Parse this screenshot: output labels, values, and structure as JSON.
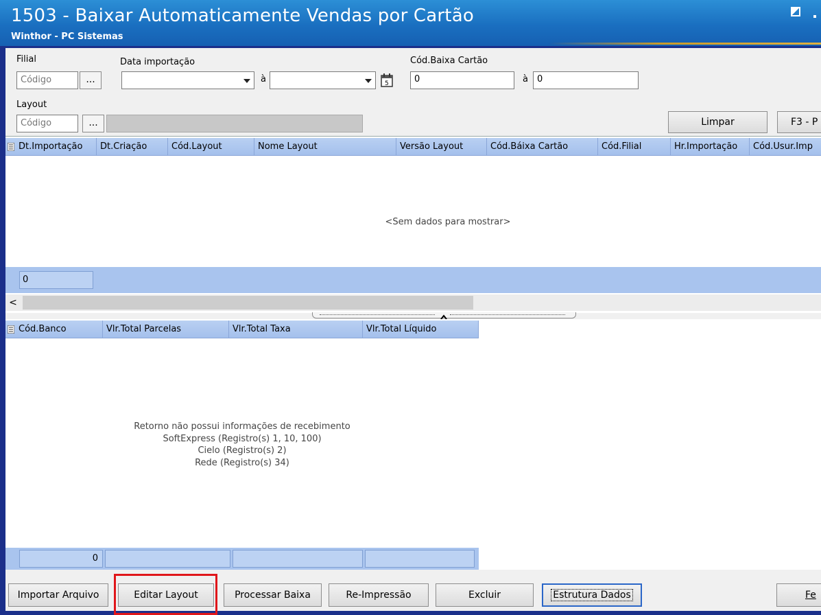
{
  "window": {
    "title": "1503 - Baixar Automaticamente Vendas por Cartão",
    "subtitle": "Winthor - PC Sistemas"
  },
  "filters": {
    "filial_label": "Filial",
    "filial_placeholder": "Código",
    "data_importacao_label": "Data importação",
    "date_separator": "à",
    "cod_baixa_label": "Cód.Baixa Cartão",
    "cod_baixa_from": "0",
    "cod_baixa_to": "0",
    "layout_label": "Layout",
    "layout_placeholder": "Código",
    "ellipsis": "...",
    "limpar": "Limpar",
    "pesquisar": "F3 - P"
  },
  "grid1": {
    "columns": [
      "Dt.Importação",
      "Dt.Criação",
      "Cód.Layout",
      "Nome Layout",
      "Versão Layout",
      "Cód.Báixa Cartão",
      "Cód.Filial",
      "Hr.Importação",
      "Cód.Usur.Imp"
    ],
    "empty_text": "<Sem dados para mostrar>",
    "footer_count": "0",
    "scroll_left": "<"
  },
  "grid2": {
    "columns": [
      "Cód.Banco",
      "Vlr.Total Parcelas",
      "Vlr.Total Taxa",
      "Vlr.Total Líquido"
    ],
    "message_lines": [
      "Retorno não possui informações de recebimento",
      "SoftExpress (Registro(s) 1, 10, 100)",
      "Cielo (Registro(s) 2)",
      "Rede (Registro(s) 34)"
    ],
    "footer_first": "0"
  },
  "buttons": {
    "importar": "Importar Arquivo",
    "editar": "Editar Layout",
    "processar": "Processar Baixa",
    "reimpressao": "Re-Impressão",
    "excluir": "Excluir",
    "estrutura": "Estrutura Dados",
    "fechar": "Fe"
  }
}
